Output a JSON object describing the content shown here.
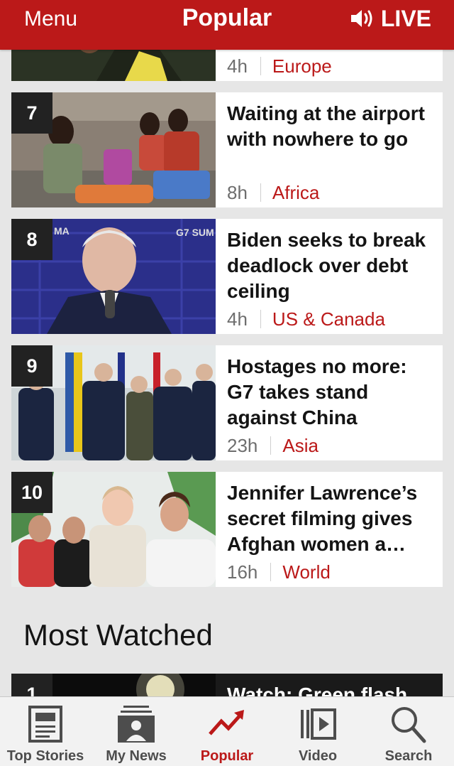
{
  "header": {
    "menu_label": "Menu",
    "title": "Popular",
    "live_label": "LIVE"
  },
  "partial_item": {
    "time": "4h",
    "section": "Europe"
  },
  "popular_items": [
    {
      "rank": "7",
      "headline": "Waiting at the airport with nowhere to go",
      "time": "8h",
      "section": "Africa"
    },
    {
      "rank": "8",
      "headline": "Biden seeks to break deadlock over debt ceiling",
      "time": "4h",
      "section": "US & Canada"
    },
    {
      "rank": "9",
      "headline": "Hostages no more: G7 takes stand against China",
      "time": "23h",
      "section": "Asia"
    },
    {
      "rank": "10",
      "headline": "Jennifer Lawrence’s secret filming gives Afghan women a voice",
      "time": "16h",
      "section": "World"
    }
  ],
  "most_watched": {
    "heading": "Most Watched",
    "items": [
      {
        "rank": "1",
        "headline": "Watch: Green flash"
      }
    ]
  },
  "tabbar": {
    "items": [
      {
        "label": "Top Stories",
        "icon": "top-stories-icon",
        "active": false
      },
      {
        "label": "My News",
        "icon": "my-news-icon",
        "active": false
      },
      {
        "label": "Popular",
        "icon": "popular-icon",
        "active": true
      },
      {
        "label": "Video",
        "icon": "video-icon",
        "active": false
      },
      {
        "label": "Search",
        "icon": "search-icon",
        "active": false
      }
    ]
  },
  "colors": {
    "brand_red": "#bb1919",
    "background": "#e6e6e6",
    "card": "#ffffff",
    "meta_grey": "#6e6e6e",
    "rank_badge": "#222222"
  }
}
